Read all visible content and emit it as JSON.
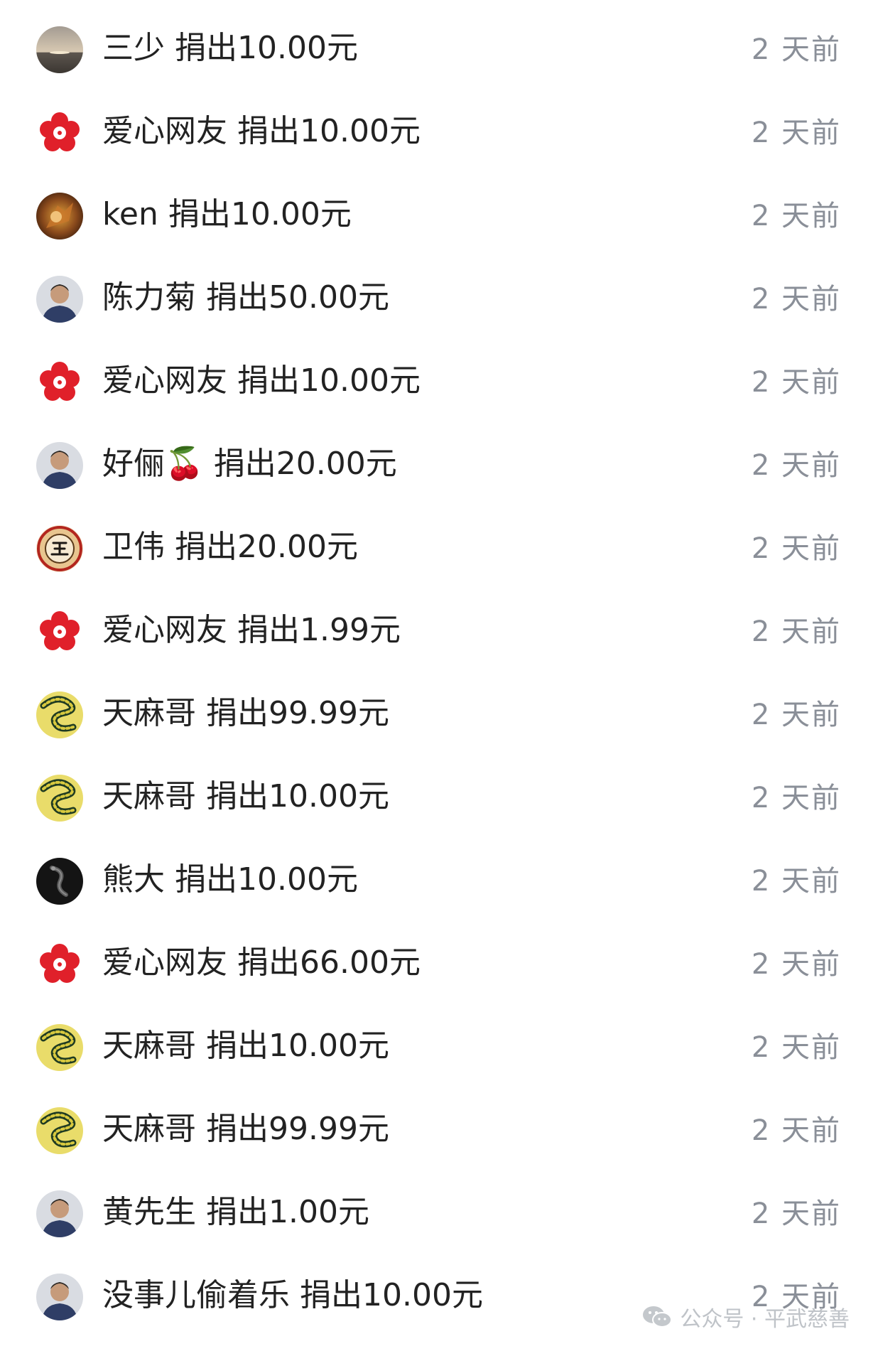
{
  "rows": [
    {
      "name": "三少",
      "amount": "捐出10.00元",
      "time": "2 天前",
      "avatar": "sunset-avatar-icon"
    },
    {
      "name": "爱心网友",
      "amount": "捐出10.00元",
      "time": "2 天前",
      "avatar": "red-flower-avatar-icon"
    },
    {
      "name": "ken",
      "amount": "捐出10.00元",
      "time": "2 天前",
      "avatar": "warrior-avatar-icon"
    },
    {
      "name": "陈力菊",
      "amount": "捐出50.00元",
      "time": "2 天前",
      "avatar": "person-avatar-icon"
    },
    {
      "name": "爱心网友",
      "amount": "捐出10.00元",
      "time": "2 天前",
      "avatar": "red-flower-avatar-icon"
    },
    {
      "name": "好俪🍒",
      "amount": "捐出20.00元",
      "time": "2 天前",
      "avatar": "person-avatar-icon"
    },
    {
      "name": "卫伟",
      "amount": "捐出20.00元",
      "time": "2 天前",
      "avatar": "wang-badge-avatar-icon"
    },
    {
      "name": "爱心网友",
      "amount": "捐出1.99元",
      "time": "2 天前",
      "avatar": "red-flower-avatar-icon"
    },
    {
      "name": "天麻哥",
      "amount": "捐出99.99元",
      "time": "2 天前",
      "avatar": "golden-dragon-avatar-icon"
    },
    {
      "name": "天麻哥",
      "amount": "捐出10.00元",
      "time": "2 天前",
      "avatar": "golden-dragon-avatar-icon"
    },
    {
      "name": "熊大",
      "amount": "捐出10.00元",
      "time": "2 天前",
      "avatar": "dark-dragon-avatar-icon"
    },
    {
      "name": "爱心网友",
      "amount": "捐出66.00元",
      "time": "2 天前",
      "avatar": "red-flower-avatar-icon"
    },
    {
      "name": "天麻哥",
      "amount": "捐出10.00元",
      "time": "2 天前",
      "avatar": "golden-dragon-avatar-icon"
    },
    {
      "name": "天麻哥",
      "amount": "捐出99.99元",
      "time": "2 天前",
      "avatar": "golden-dragon-avatar-icon"
    },
    {
      "name": "黄先生",
      "amount": "捐出1.00元",
      "time": "2 天前",
      "avatar": "person-avatar-icon"
    },
    {
      "name": "没事儿偷着乐",
      "amount": "捐出10.00元",
      "time": "2 天前",
      "avatar": "person-avatar-icon"
    }
  ],
  "watermark": {
    "text": "公众号 · 平武慈善",
    "icon": "wechat-icon"
  }
}
